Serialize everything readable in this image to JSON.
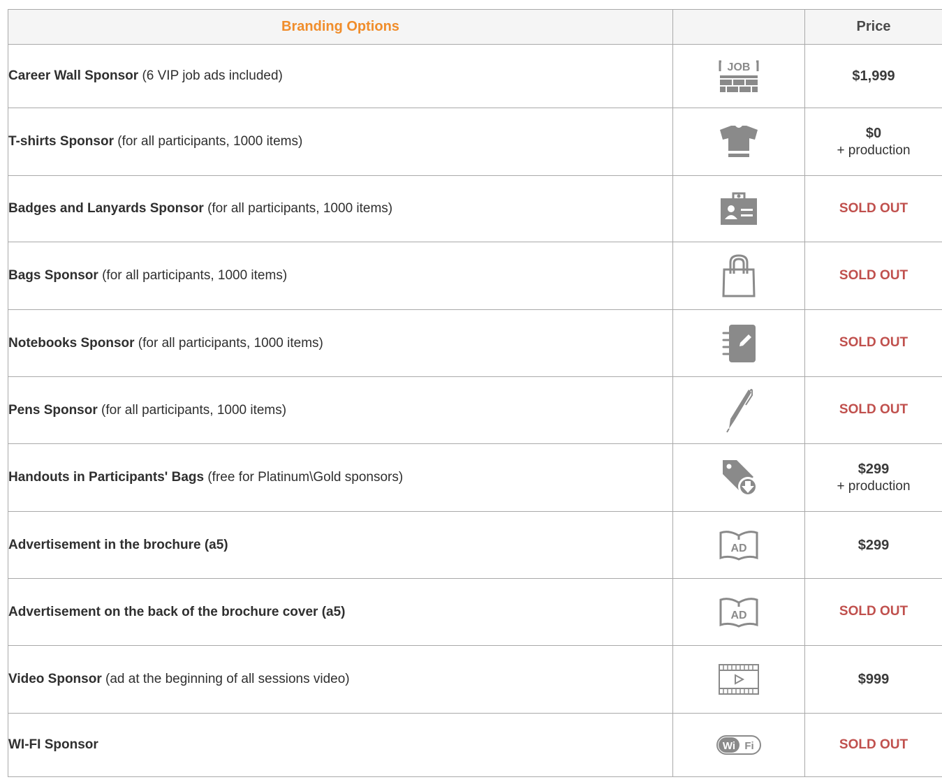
{
  "header": {
    "col_name": "Branding Options",
    "col_icon": "",
    "col_price": "Price"
  },
  "colors": {
    "header_accent": "#f08d2b",
    "sold_out": "#c0504d",
    "icon_gray": "#8a8a8a"
  },
  "rows": [
    {
      "name_bold": "Career Wall Sponsor",
      "name_rest": " (6 VIP job ads included)",
      "icon": "job-icon",
      "price": "$1,999",
      "price_note": "",
      "status": "available"
    },
    {
      "name_bold": "T-shirts Sponsor",
      "name_rest": " (for all participants, 1000 items)",
      "icon": "tshirt-icon",
      "price": "$0",
      "price_note": "+ production",
      "status": "available"
    },
    {
      "name_bold": "Badges and Lanyards Sponsor",
      "name_rest": " (for all participants, 1000 items)",
      "icon": "badge-icon",
      "price": "SOLD OUT",
      "price_note": "",
      "status": "sold"
    },
    {
      "name_bold": "Bags Sponsor",
      "name_rest": " (for all participants, 1000 items)",
      "icon": "bag-icon",
      "price": "SOLD OUT",
      "price_note": "",
      "status": "sold"
    },
    {
      "name_bold": "Notebooks Sponsor",
      "name_rest": " (for all participants, 1000 items)",
      "icon": "notebook-icon",
      "price": "SOLD OUT",
      "price_note": "",
      "status": "sold"
    },
    {
      "name_bold": "Pens Sponsor",
      "name_rest": " (for all participants, 1000 items)",
      "icon": "pen-icon",
      "price": "SOLD OUT",
      "price_note": "",
      "status": "sold"
    },
    {
      "name_bold": "Handouts in Participants' Bags",
      "name_rest": " (free for Platinum\\Gold sponsors)",
      "icon": "tag-download-icon",
      "price": "$299",
      "price_note": "+ production",
      "status": "available"
    },
    {
      "name_bold": "Advertisement in the brochure (a5)",
      "name_rest": "",
      "icon": "ad-book-icon",
      "price": "$299",
      "price_note": "",
      "status": "available"
    },
    {
      "name_bold": "Advertisement on the back of the brochure cover (a5)",
      "name_rest": "",
      "icon": "ad-book-icon",
      "price": "SOLD OUT",
      "price_note": "",
      "status": "sold"
    },
    {
      "name_bold": "Video Sponsor",
      "name_rest": " (ad at the beginning of all sessions video)",
      "icon": "video-icon",
      "price": "$999",
      "price_note": "",
      "status": "available"
    },
    {
      "name_bold": "WI-FI Sponsor",
      "name_rest": "",
      "icon": "wifi-icon",
      "price": "SOLD OUT",
      "price_note": "",
      "status": "sold"
    }
  ],
  "icon_text": {
    "job": "JOB",
    "ad": "AD",
    "wifi_a": "Wi",
    "wifi_b": "Fi"
  }
}
